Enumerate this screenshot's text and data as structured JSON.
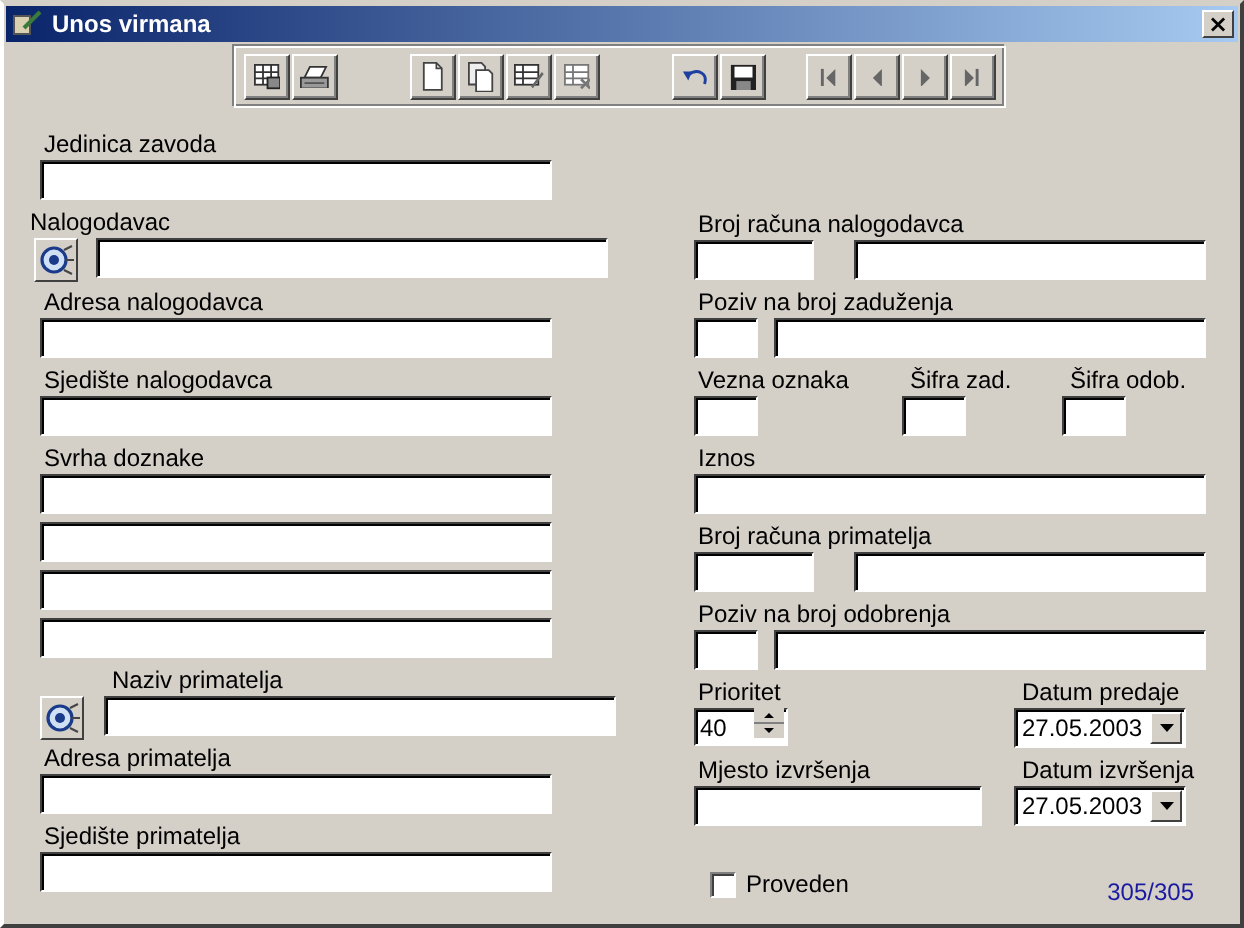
{
  "window": {
    "title": "Unos virmana",
    "close": "×"
  },
  "toolbar": {
    "groups": [
      [
        {
          "kind": "table"
        },
        {
          "kind": "printer"
        }
      ],
      [
        {
          "kind": "new"
        },
        {
          "kind": "copy"
        },
        {
          "kind": "edit"
        },
        {
          "kind": "delete"
        }
      ],
      [
        {
          "kind": "undo"
        },
        {
          "kind": "save"
        }
      ],
      [
        {
          "kind": "first"
        },
        {
          "kind": "prev"
        },
        {
          "kind": "next"
        },
        {
          "kind": "last"
        }
      ]
    ]
  },
  "left": [
    {
      "kind": "text",
      "label": "Jedinica zavoda"
    },
    {
      "kind": "lookup",
      "label": "Nalogodavac"
    },
    {
      "kind": "text",
      "label": "Adresa nalogodavca"
    },
    {
      "kind": "text",
      "label": "Sjedište nalogodavca"
    },
    {
      "kind": "text",
      "label": "Svrha doznake"
    },
    {
      "kind": "line"
    },
    {
      "kind": "line"
    },
    {
      "kind": "line"
    },
    {
      "kind": "lookup_titled",
      "label": "Naziv primatelja"
    },
    {
      "kind": "text",
      "label": "Adresa primatelja"
    },
    {
      "kind": "text",
      "label": "Sjedište primatelja"
    }
  ],
  "right": [
    {
      "kind": "account",
      "label": "Broj računa nalogodavca"
    },
    {
      "kind": "reference",
      "label": "Poziv na broj zaduženja"
    },
    {
      "kind": "codes",
      "labels": [
        "Vezna oznaka",
        "Šifra zad.",
        "Šifra odob."
      ]
    },
    {
      "kind": "text",
      "label": "Iznos"
    },
    {
      "kind": "account",
      "label": "Broj računa primatelja"
    },
    {
      "kind": "reference",
      "label": "Poziv na broj odobrenja"
    },
    {
      "kind": "spin_date",
      "label": "Prioritet",
      "value": "40",
      "date_label": "Datum predaje",
      "date": "27.05.2003"
    },
    {
      "kind": "text_date",
      "label": "Mjesto izvršenja",
      "date_label": "Datum izvršenja",
      "date": "27.05.2003"
    }
  ],
  "footer": {
    "checkbox": {
      "label": "Proveden",
      "checked": false
    },
    "record_counter": "305/305"
  }
}
